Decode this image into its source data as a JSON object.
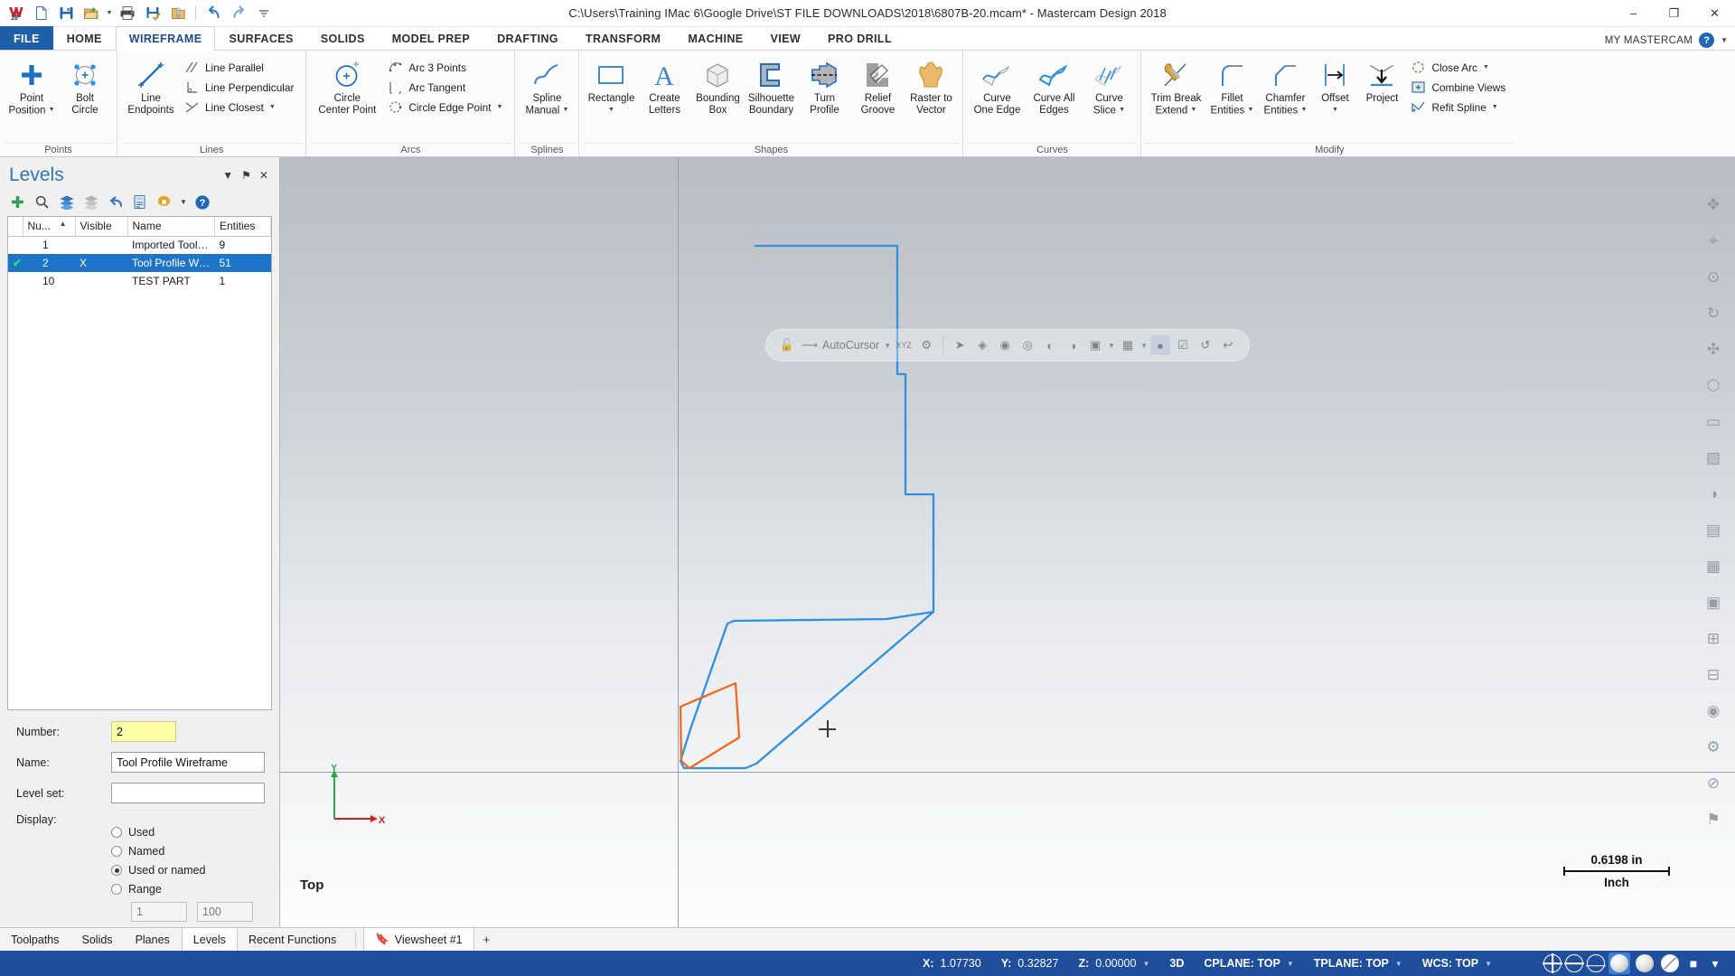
{
  "window": {
    "title": "C:\\Users\\Training IMac 6\\Google Drive\\ST FILE DOWNLOADS\\2018\\6807B-20.mcam* - Mastercam Design 2018",
    "minimize": "–",
    "maximize": "❐",
    "close": "✕"
  },
  "quick_access": {
    "items": [
      {
        "name": "mastercam-logo-icon",
        "label": "M18"
      },
      {
        "name": "new-file-icon",
        "label": "New"
      },
      {
        "name": "save-icon",
        "label": "Save"
      },
      {
        "name": "open-folder-icon",
        "label": "Open"
      },
      {
        "name": "print-icon",
        "label": "Print"
      },
      {
        "name": "save-as-icon",
        "label": "Save As"
      },
      {
        "name": "zip2go-icon",
        "label": "Zip2Go"
      },
      {
        "name": "undo-icon",
        "label": "Undo"
      },
      {
        "name": "redo-icon",
        "label": "Redo"
      },
      {
        "name": "customize-qat-icon",
        "label": "Customize"
      }
    ]
  },
  "ribbon_tabs": [
    {
      "label": "FILE",
      "active": false,
      "file": true
    },
    {
      "label": "HOME",
      "active": false
    },
    {
      "label": "WIREFRAME",
      "active": true
    },
    {
      "label": "SURFACES",
      "active": false
    },
    {
      "label": "SOLIDS",
      "active": false
    },
    {
      "label": "MODEL PREP",
      "active": false
    },
    {
      "label": "DRAFTING",
      "active": false
    },
    {
      "label": "TRANSFORM",
      "active": false
    },
    {
      "label": "MACHINE",
      "active": false
    },
    {
      "label": "VIEW",
      "active": false
    },
    {
      "label": "PRO DRILL",
      "active": false
    }
  ],
  "tab_right": {
    "my_mastercam": "MY MASTERCAM",
    "help": "?",
    "collapse": "▼"
  },
  "ribbon_groups": [
    {
      "name": "points",
      "label": "Points",
      "big": [
        {
          "label1": "Point",
          "label2": "Position",
          "dropdown": true,
          "icon": "point-position-icon"
        },
        {
          "label1": "Bolt",
          "label2": "Circle",
          "dropdown": false,
          "icon": "bolt-circle-icon"
        }
      ],
      "small": []
    },
    {
      "name": "lines",
      "label": "Lines",
      "big": [
        {
          "label1": "Line",
          "label2": "Endpoints",
          "dropdown": false,
          "icon": "line-endpoints-icon"
        }
      ],
      "small": [
        {
          "label": "Line Parallel",
          "dropdown": false,
          "icon": "line-parallel-icon"
        },
        {
          "label": "Line Perpendicular",
          "dropdown": false,
          "icon": "line-perpendicular-icon"
        },
        {
          "label": "Line Closest",
          "dropdown": true,
          "icon": "line-closest-icon"
        }
      ]
    },
    {
      "name": "arcs",
      "label": "Arcs",
      "big": [
        {
          "label1": "Circle",
          "label2": "Center Point",
          "dropdown": false,
          "icon": "circle-center-point-icon"
        }
      ],
      "small": [
        {
          "label": "Arc 3 Points",
          "dropdown": false,
          "icon": "arc-3-points-icon"
        },
        {
          "label": "Arc Tangent",
          "dropdown": false,
          "icon": "arc-tangent-icon"
        },
        {
          "label": "Circle Edge Point",
          "dropdown": true,
          "icon": "circle-edge-point-icon"
        }
      ]
    },
    {
      "name": "splines",
      "label": "Splines",
      "big": [
        {
          "label1": "Spline",
          "label2": "Manual",
          "dropdown": true,
          "icon": "spline-manual-icon"
        }
      ],
      "small": []
    },
    {
      "name": "shapes",
      "label": "Shapes",
      "big": [
        {
          "label1": "Rectangle",
          "label2": "",
          "dropdown": true,
          "icon": "rectangle-icon"
        },
        {
          "label1": "Create",
          "label2": "Letters",
          "dropdown": false,
          "icon": "create-letters-icon"
        },
        {
          "label1": "Bounding",
          "label2": "Box",
          "dropdown": false,
          "icon": "bounding-box-icon"
        },
        {
          "label1": "Silhouette",
          "label2": "Boundary",
          "dropdown": false,
          "icon": "silhouette-boundary-icon"
        },
        {
          "label1": "Turn",
          "label2": "Profile",
          "dropdown": false,
          "icon": "turn-profile-icon"
        },
        {
          "label1": "Relief",
          "label2": "Groove",
          "dropdown": false,
          "icon": "relief-groove-icon"
        },
        {
          "label1": "Raster to",
          "label2": "Vector",
          "dropdown": false,
          "icon": "raster-to-vector-icon"
        }
      ],
      "small": []
    },
    {
      "name": "curves",
      "label": "Curves",
      "big": [
        {
          "label1": "Curve",
          "label2": "One Edge",
          "dropdown": false,
          "icon": "curve-one-edge-icon"
        },
        {
          "label1": "Curve All",
          "label2": "Edges",
          "dropdown": false,
          "icon": "curve-all-edges-icon"
        },
        {
          "label1": "Curve",
          "label2": "Slice",
          "dropdown": true,
          "icon": "curve-slice-icon"
        }
      ],
      "small": []
    },
    {
      "name": "modify",
      "label": "Modify",
      "big": [
        {
          "label1": "Trim Break",
          "label2": "Extend",
          "dropdown": true,
          "icon": "trim-break-extend-icon"
        },
        {
          "label1": "Fillet",
          "label2": "Entities",
          "dropdown": true,
          "icon": "fillet-entities-icon"
        },
        {
          "label1": "Chamfer",
          "label2": "Entities",
          "dropdown": true,
          "icon": "chamfer-entities-icon"
        },
        {
          "label1": "Offset",
          "label2": "",
          "dropdown": true,
          "icon": "offset-icon"
        },
        {
          "label1": "Project",
          "label2": "",
          "dropdown": false,
          "icon": "project-icon"
        }
      ],
      "small": [
        {
          "label": "Close Arc",
          "dropdown": true,
          "icon": "close-arc-icon"
        },
        {
          "label": "Combine Views",
          "dropdown": false,
          "icon": "combine-views-icon"
        },
        {
          "label": "Refit Spline",
          "dropdown": true,
          "icon": "refit-spline-icon"
        }
      ]
    }
  ],
  "levels_panel": {
    "title": "Levels",
    "header_buttons": [
      {
        "name": "panel-dropdown-icon",
        "glyph": "▼"
      },
      {
        "name": "panel-pin-icon",
        "glyph": "⚑"
      },
      {
        "name": "panel-close-icon",
        "glyph": "✕"
      }
    ],
    "toolbar": [
      {
        "name": "add-level-icon",
        "glyph": "+"
      },
      {
        "name": "find-level-icon",
        "glyph": "search"
      },
      {
        "name": "show-all-levels-icon",
        "glyph": "layers-blue"
      },
      {
        "name": "hide-all-levels-icon",
        "glyph": "layers-gray"
      },
      {
        "name": "undo-levels-icon",
        "glyph": "undo"
      },
      {
        "name": "level-numbering-icon",
        "glyph": "numbering"
      },
      {
        "name": "level-settings-icon",
        "glyph": "gear"
      },
      {
        "name": "levels-help-icon",
        "glyph": "?"
      }
    ],
    "columns": [
      "Nu...",
      "Visible",
      "Name",
      "Entities"
    ],
    "rows": [
      {
        "checked": false,
        "number": "1",
        "visible": "",
        "name": "Imported Tool Solid",
        "entities": "9",
        "selected": false
      },
      {
        "checked": true,
        "number": "2",
        "visible": "X",
        "name": "Tool Profile Wirefr...",
        "entities": "51",
        "selected": true
      },
      {
        "checked": false,
        "number": "10",
        "visible": "",
        "name": "TEST PART",
        "entities": "1",
        "selected": false
      }
    ],
    "properties": {
      "number_label": "Number:",
      "number_value": "2",
      "name_label": "Name:",
      "name_value": "Tool Profile Wireframe",
      "levelset_label": "Level set:",
      "levelset_value": "",
      "display_label": "Display:",
      "display_options": [
        {
          "label": "Used",
          "selected": false
        },
        {
          "label": "Named",
          "selected": false
        },
        {
          "label": "Used or named",
          "selected": true
        },
        {
          "label": "Range",
          "selected": false
        }
      ],
      "range_from": "1",
      "range_to": "100"
    }
  },
  "graphics": {
    "autocursor": {
      "label": "AutoCursor",
      "icons": [
        {
          "name": "lock-icon",
          "glyph": "🔓"
        },
        {
          "name": "autocursor-arrow-icon",
          "glyph": "↖"
        },
        {
          "name": "autocursor-dropdown-icon",
          "glyph": "▾"
        },
        {
          "name": "xyz-point-icon",
          "glyph": "xyz"
        },
        {
          "name": "autocursor-settings-icon",
          "glyph": "gear"
        },
        {
          "name": "select-arrow-icon",
          "glyph": "↖"
        },
        {
          "name": "select-wireframe-icon",
          "glyph": "wire"
        },
        {
          "name": "select-solid-face-icon",
          "glyph": "face"
        },
        {
          "name": "select-solid-edge-icon",
          "glyph": "edge"
        },
        {
          "name": "select-surface-icon",
          "glyph": "surf"
        },
        {
          "name": "select-shading-icon",
          "glyph": "shade"
        },
        {
          "name": "select-all-icon",
          "glyph": "all"
        },
        {
          "name": "select-all-dropdown-icon",
          "glyph": "▾"
        },
        {
          "name": "select-only-icon",
          "glyph": "only"
        },
        {
          "name": "select-only-dropdown-icon",
          "glyph": "▾"
        },
        {
          "name": "selection-mask-icon",
          "glyph": "mask"
        },
        {
          "name": "verify-selection-icon",
          "glyph": "verify"
        },
        {
          "name": "rotate-view-icon",
          "glyph": "rot"
        },
        {
          "name": "undo-selection-icon",
          "glyph": "undo"
        }
      ]
    },
    "view_name": "Top",
    "gnomon": {
      "x_label": "X",
      "y_label": "Y"
    },
    "scale": {
      "value": "0.6198 in",
      "unit": "Inch"
    },
    "right_toolbar": [
      {
        "name": "fit-view-icon",
        "glyph": "✥"
      },
      {
        "name": "zoom-window-icon",
        "glyph": "⌖"
      },
      {
        "name": "unzoom-icon",
        "glyph": "⊙"
      },
      {
        "name": "dynamic-rotate-icon",
        "glyph": "↻"
      },
      {
        "name": "pan-icon",
        "glyph": "✣"
      },
      {
        "name": "isometric-view-icon",
        "glyph": "⬡"
      },
      {
        "name": "front-view-icon",
        "glyph": "▭"
      },
      {
        "name": "wireframe-shade-icon",
        "glyph": "▧"
      },
      {
        "name": "shaded-view-icon",
        "glyph": "◑"
      },
      {
        "name": "translucency-icon",
        "glyph": "▤"
      },
      {
        "name": "hidden-lines-icon",
        "glyph": "▦"
      },
      {
        "name": "section-view-icon",
        "glyph": "▣"
      },
      {
        "name": "wireframe-display-icon",
        "glyph": "⊞"
      },
      {
        "name": "blank-entity-icon",
        "glyph": "⊟"
      },
      {
        "name": "clear-colors-icon",
        "glyph": "◉"
      },
      {
        "name": "screen-settings-icon",
        "glyph": "⚙"
      },
      {
        "name": "hide-entity-icon",
        "glyph": "⊘"
      },
      {
        "name": "pin-toolbar-icon",
        "glyph": "⚑"
      }
    ],
    "colors": {
      "wireframe_blue": "#2f8fe0",
      "wireframe_orange": "#ef6a1f",
      "axis": "#9aa0a6"
    }
  },
  "bottom_tabs": [
    {
      "label": "Toolpaths",
      "active": false
    },
    {
      "label": "Solids",
      "active": false
    },
    {
      "label": "Planes",
      "active": false
    },
    {
      "label": "Levels",
      "active": true
    },
    {
      "label": "Recent Functions",
      "active": false
    }
  ],
  "viewsheet": {
    "label": "Viewsheet #1",
    "add": "+"
  },
  "statusbar": {
    "coords": [
      {
        "key": "X:",
        "value": "1.07730",
        "dropdown": false
      },
      {
        "key": "Y:",
        "value": "0.32827",
        "dropdown": false
      },
      {
        "key": "Z:",
        "value": "0.00000",
        "dropdown": true
      }
    ],
    "mode": "3D",
    "planes": [
      {
        "label": "CPLANE: TOP",
        "dropdown": true
      },
      {
        "label": "TPLANE: TOP",
        "dropdown": true
      },
      {
        "label": "WCS: TOP",
        "dropdown": true
      }
    ],
    "icons": [
      {
        "name": "wireframe-globe-icon",
        "selected": false
      },
      {
        "name": "hidden-lines-globe-icon",
        "selected": false
      },
      {
        "name": "shaded-outline-globe-icon",
        "selected": false
      },
      {
        "name": "shaded-sphere-icon",
        "selected": true
      },
      {
        "name": "flat-shaded-sphere-icon",
        "selected": false
      },
      {
        "name": "translucent-sphere-icon",
        "selected": false
      },
      {
        "name": "material-icon",
        "selected": false
      },
      {
        "name": "display-options-icon",
        "selected": false
      }
    ]
  }
}
